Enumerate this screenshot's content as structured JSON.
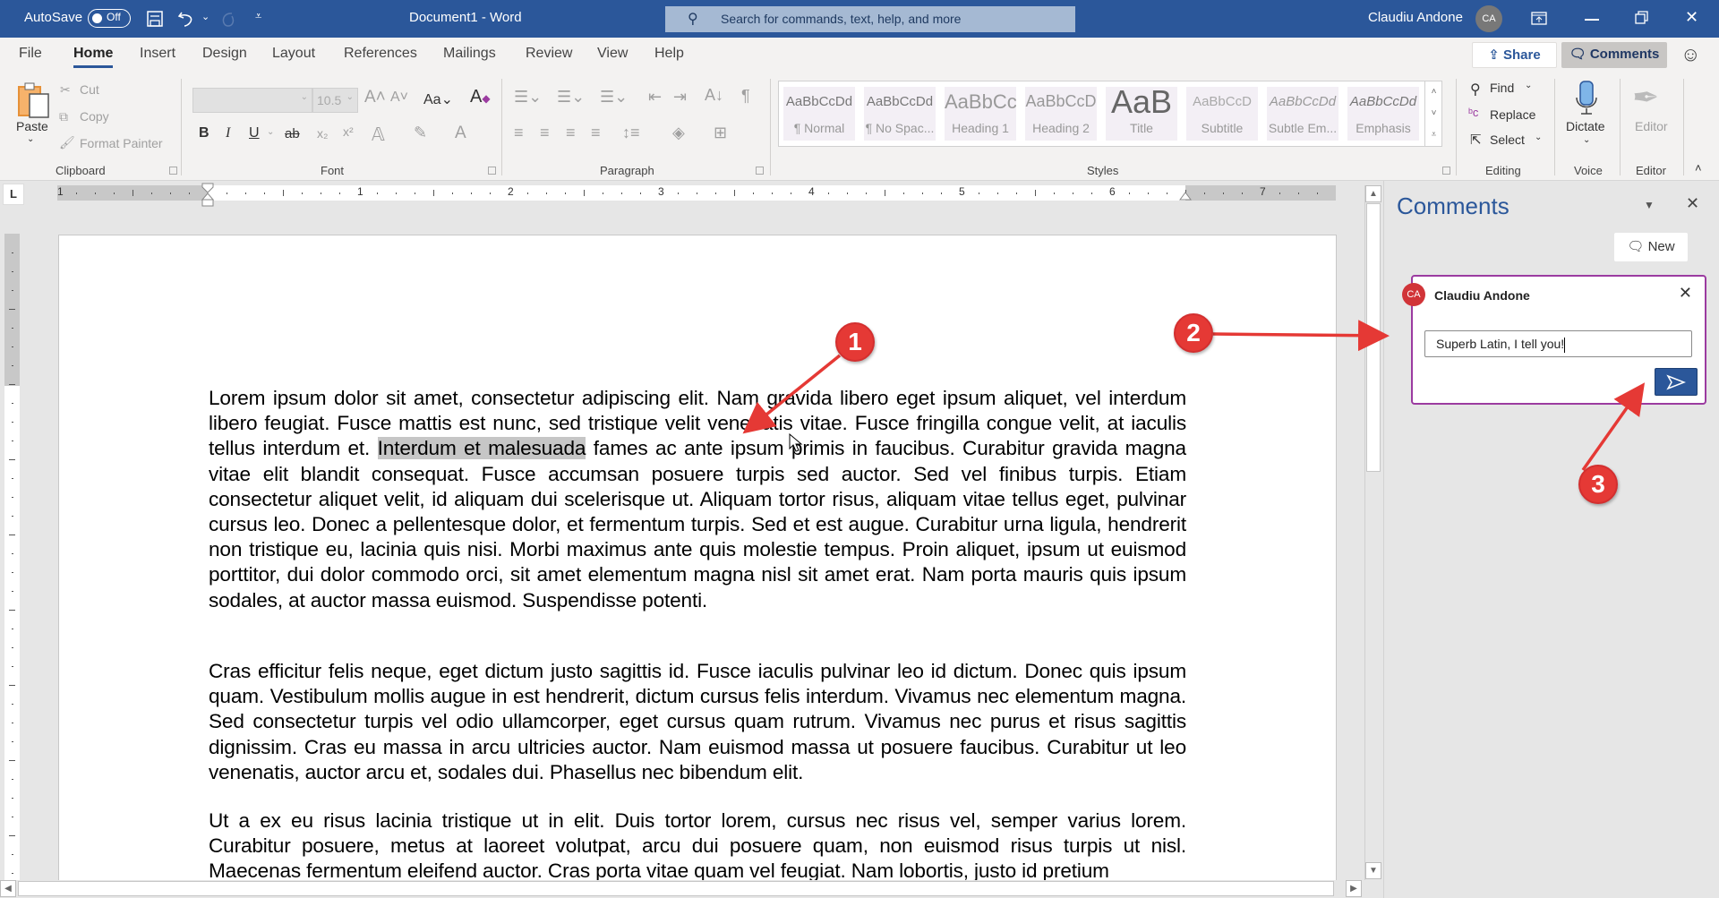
{
  "titlebar": {
    "autosave_label": "AutoSave",
    "autosave_state": "Off",
    "doc_title": "Document1  -  Word",
    "search_placeholder": "Search for commands, text, help, and more",
    "user_name": "Claudiu Andone",
    "user_initials": "CA",
    "icons": [
      "save-icon",
      "undo-icon",
      "redo-icon",
      "customize-qat-icon",
      "ribbon-display-icon",
      "minimize-icon",
      "restore-icon",
      "close-icon"
    ]
  },
  "tabs": [
    "File",
    "Home",
    "Insert",
    "Design",
    "Layout",
    "References",
    "Mailings",
    "Review",
    "View",
    "Help"
  ],
  "active_tab": "Home",
  "tabbar_right": {
    "share": "Share",
    "comments": "Comments"
  },
  "ribbon": {
    "clipboard": {
      "paste": "Paste",
      "cut": "Cut",
      "copy": "Copy",
      "format_painter": "Format Painter",
      "label": "Clipboard"
    },
    "font": {
      "font_name": "",
      "font_size": "10.5",
      "label": "Font"
    },
    "paragraph": {
      "label": "Paragraph"
    },
    "styles": {
      "label": "Styles",
      "items": [
        {
          "sample": "AaBbCcDd",
          "name": "¶ Normal"
        },
        {
          "sample": "AaBbCcDd",
          "name": "¶ No Spac..."
        },
        {
          "sample": "AaBbCc",
          "name": "Heading 1"
        },
        {
          "sample": "AaBbCcD",
          "name": "Heading 2"
        },
        {
          "sample": "AaB",
          "name": "Title"
        },
        {
          "sample": "AaBbCcD",
          "name": "Subtitle"
        },
        {
          "sample": "AaBbCcDd",
          "name": "Subtle Em..."
        },
        {
          "sample": "AaBbCcDd",
          "name": "Emphasis"
        }
      ]
    },
    "editing": {
      "find": "Find",
      "replace": "Replace",
      "select": "Select",
      "label": "Editing"
    },
    "voice": {
      "dictate": "Dictate",
      "label": "Voice"
    },
    "editor": {
      "editor": "Editor",
      "label": "Editor"
    }
  },
  "ruler": {
    "unit_labels": [
      "1",
      "1",
      "2",
      "3",
      "4",
      "5",
      "6",
      "7"
    ],
    "corner": "L"
  },
  "document": {
    "paragraphs": [
      {
        "before": "Lorem ipsum dolor sit amet, consectetur adipiscing elit. Nam gravida libero eget ipsum aliquet, vel interdum libero feugiat. Fusce mattis est nunc, sed tristique velit venenatis vitae. Fusce fringilla congue velit, at iaculis tellus interdum et. ",
        "selected": "Interdum et malesuada",
        "after": " fames ac ante ipsum primis in faucibus. Curabitur gravida magna vitae elit blandit consequat. Fusce accumsan posuere turpis sed auctor. Sed vel finibus turpis. Etiam consectetur aliquet velit, id aliquam dui scelerisque ut. Aliquam tortor risus, aliquam vitae tellus eget, pulvinar cursus leo. Donec a pellentesque dolor, et fermentum turpis. Sed et est augue. Curabitur urna ligula, hendrerit non tristique eu, lacinia quis nisi. Morbi maximus ante quis molestie tempus. Proin aliquet, ipsum ut euismod porttitor, dui dolor commodo orci, sit amet elementum magna nisl sit amet erat. Nam porta mauris quis ipsum sodales, at auctor massa euismod. Suspendisse potenti."
      },
      {
        "text": "Cras efficitur felis neque, eget dictum justo sagittis id. Fusce iaculis pulvinar leo id dictum. Donec quis ipsum quam. Vestibulum mollis augue in est hendrerit, dictum cursus felis interdum. Vivamus nec elementum magna. Sed consectetur turpis vel odio ullamcorper, eget cursus quam rutrum. Vivamus nec purus et risus sagittis dignissim. Cras eu massa in arcu ultricies auctor. Nam euismod massa ut posuere faucibus. Curabitur ut leo venenatis, auctor arcu et, sodales dui. Phasellus nec bibendum elit."
      },
      {
        "text": "Ut a ex eu risus lacinia tristique ut in elit. Duis tortor lorem, cursus nec risus vel, semper varius lorem. Curabitur posuere, metus at laoreet volutpat, arcu dui posuere quam, non euismod risus turpis ut nisl. Maecenas fermentum eleifend auctor. Cras porta vitae quam vel feugiat. Nam lobortis, justo id pretium"
      }
    ]
  },
  "comments_pane": {
    "title": "Comments",
    "new_label": "New",
    "comment": {
      "author": "Claudiu Andone",
      "initials": "CA",
      "draft_text": "Superb Latin, I tell you!"
    }
  },
  "annotations": [
    "1",
    "2",
    "3"
  ],
  "colors": {
    "brand": "#2b579a",
    "comment_border": "#9b3ba0",
    "avatar": "#d13438",
    "marker": "#e53935"
  }
}
